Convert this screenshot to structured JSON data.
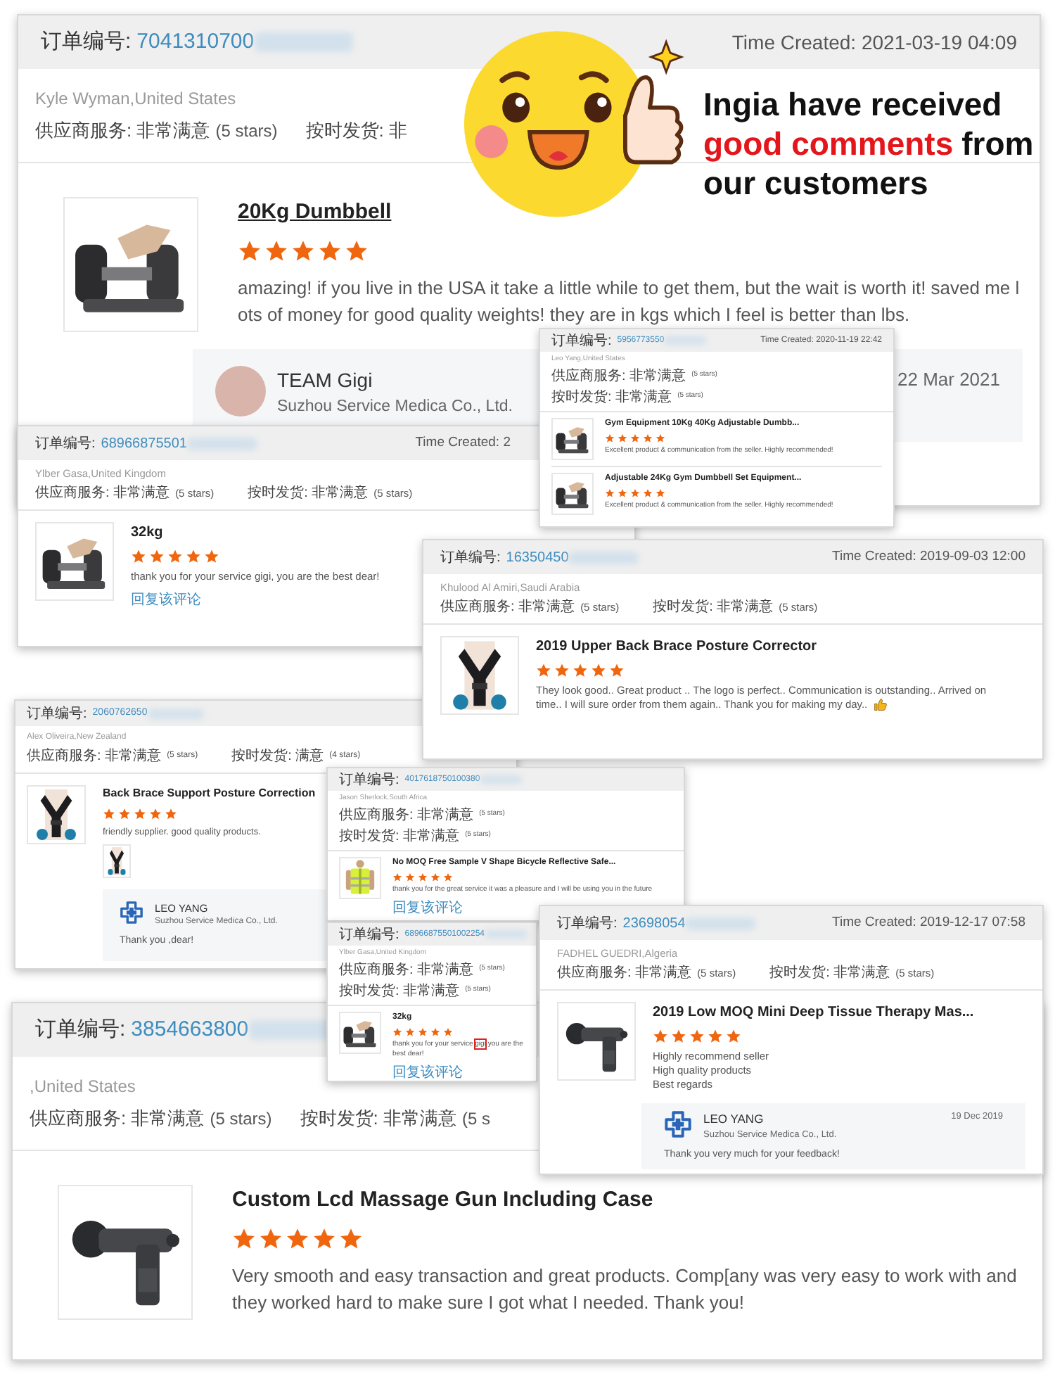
{
  "headline": {
    "lines": [
      [
        {
          "text": "Ingia have received",
          "accent": false
        }
      ],
      [
        {
          "text": "good comments",
          "accent": true
        },
        {
          "text": "from",
          "accent": false
        }
      ],
      [
        {
          "text": "our customers",
          "accent": false
        }
      ]
    ]
  },
  "cards": [
    {
      "order_label": "订单编号:",
      "order_no": "7041310700",
      "time": "Time Created: 2021-03-19 04:09",
      "buyer": "Kyle Wyman,United States",
      "ratings": [
        {
          "label": "供应商服务: 非常满意",
          "stars": "(5 stars)"
        },
        {
          "label": "按时发货: 非"
        }
      ],
      "products": [
        {
          "title": "20Kg Dumbbell",
          "underlined": true,
          "stars": 5,
          "review": [
            "amazing! if you live in the USA it take a little while to get them, but the wait is worth it! saved me l",
            "ots of money for good quality weights! they are in kgs which I feel is better than lbs."
          ]
        }
      ],
      "reply": {
        "kind": "avatar",
        "name": "TEAM Gigi",
        "company": "Suzhou Service Medica Co., Ltd.",
        "date": "22 Mar 2021"
      }
    },
    {
      "order_label": "订单编号:",
      "order_no": "68966875501",
      "time": "Time Created: 2",
      "buyer": "Ylber Gasa,United Kingdom",
      "ratings": [
        {
          "label": "供应商服务: 非常满意",
          "stars": "(5 stars)"
        },
        {
          "label": "按时发货: 非常满意",
          "stars": "(5 stars)"
        }
      ],
      "products": [
        {
          "title": "32kg",
          "underlined": false,
          "stars": 5,
          "review": [
            "thank you for your service gigi, you are the best dear!"
          ],
          "link": "回复该评论"
        }
      ]
    },
    {
      "order_label": "订单编号:",
      "order_no": "5956773550",
      "time": "Time Created: 2020-11-19 22:42",
      "buyer": "Leo Yang,United States",
      "ratings": [
        {
          "label": "供应商服务: 非常满意",
          "stars": "(5 stars)"
        },
        {
          "label": "按时发货: 非常满意",
          "stars": "(5 stars)"
        }
      ],
      "products": [
        {
          "title": "Gym Equipment 10Kg 40Kg Adjustable Dumbb...",
          "underlined": false,
          "stars": 5,
          "review": [
            "Excellent product & communication from the seller. Highly recommended!"
          ]
        },
        {
          "title": "Adjustable 24Kg Gym Dumbbell Set Equipment...",
          "underlined": false,
          "stars": 5,
          "review": [
            "Excellent product & communication from the seller. Highly recommended!"
          ]
        }
      ]
    },
    {
      "order_label": "订单编号:",
      "order_no": "16350450",
      "time": "Time Created: 2019-09-03 12:00",
      "buyer": "Khulood Al Amiri,Saudi Arabia",
      "ratings": [
        {
          "label": "供应商服务: 非常满意",
          "stars": "(5 stars)"
        },
        {
          "label": "按时发货: 非常满意",
          "stars": "(5 stars)"
        }
      ],
      "products": [
        {
          "title": "2019 Upper Back Brace Posture Corrector",
          "underlined": false,
          "stars": 5,
          "review": [
            "They look good.. Great product .. The logo is perfect.. Communication is outstanding.. Arrived on",
            "time.. I will sure order from them again.. Thank you for making my day.."
          ],
          "thumbs_up": true
        }
      ]
    },
    {
      "order_label": "订单编号:",
      "order_no": "2060762650",
      "buyer": "Alex Oliveira,New Zealand",
      "ratings": [
        {
          "label": "供应商服务: 非常满意",
          "stars": "(5 stars)"
        },
        {
          "label": "按时发货: 满意",
          "stars": "(4 stars)"
        }
      ],
      "products": [
        {
          "title": "Back Brace Support Posture Correction",
          "underlined": false,
          "stars": 5,
          "review": [
            "friendly supplier. good quality products."
          ],
          "photos": [
            {
              "kind": "picture"
            }
          ]
        }
      ],
      "reply": {
        "kind": "logo",
        "name": "LEO YANG",
        "company": "Suzhou Service Medica Co., Ltd.",
        "message": "Thank you ,dear!"
      }
    },
    {
      "order_label": "订单编号:",
      "order_no": "4017618750100380",
      "buyer": "Jason Sherlock,South Africa",
      "ratings": [
        {
          "label": "供应商服务: 非常满意",
          "stars": "(5 stars)"
        },
        {
          "label": "按时发货: 非常满意",
          "stars": "(5 stars)"
        }
      ],
      "products": [
        {
          "title": "No MOQ Free Sample V Shape Bicycle Reflective Safe...",
          "underlined": false,
          "stars": 5,
          "review": [
            "thank you for the great service it was a pleasure and I will be using you in the future"
          ],
          "link": "回复该评论"
        }
      ]
    },
    {
      "order_label": "订单编号:",
      "order_no": "68966875501002254",
      "buyer": "Ylber Gasa,United Kingdom",
      "ratings": [
        {
          "label": "供应商服务: 非常满意",
          "stars": "(5 stars)"
        },
        {
          "label": "按时发货: 非常满意",
          "stars": "(5 stars)"
        }
      ],
      "products": [
        {
          "title": "32kg",
          "underlined": false,
          "stars": 5,
          "review": [
            [
              {
                "text": "thank you for your service ",
                "marked": false
              },
              {
                "text": "gigi",
                "marked": true
              },
              {
                "text": " you are the best dear!",
                "marked": false
              }
            ]
          ],
          "link": "回复该评论"
        }
      ]
    },
    {
      "order_label": "订单编号:",
      "order_no": "23698054",
      "time": "Time Created: 2019-12-17 07:58",
      "buyer": "FADHEL GUEDRI,Algeria",
      "ratings": [
        {
          "label": "供应商服务: 非常满意",
          "stars": "(5 stars)"
        },
        {
          "label": "按时发货: 非常满意",
          "stars": "(5 stars)"
        }
      ],
      "products": [
        {
          "title": "2019 Low MOQ Mini Deep Tissue Therapy Mas...",
          "underlined": false,
          "stars": 5,
          "review": [
            "Highly recommend seller",
            "High quality products",
            "Best regards"
          ]
        }
      ],
      "reply": {
        "kind": "logo",
        "name": "LEO YANG",
        "company": "Suzhou Service Medica Co., Ltd.",
        "date": "19 Dec 2019",
        "message": "Thank you very much for your feedback!"
      }
    },
    {
      "order_label": "订单编号:",
      "order_no": "3854663800",
      "buyer": ",United States",
      "ratings": [
        {
          "label": "供应商服务: 非常满意",
          "stars": "(5 stars)"
        },
        {
          "label": "按时发货: 非常满意",
          "stars": "(5 s"
        }
      ],
      "products": [
        {
          "title": "Custom Lcd Massage Gun Including Case",
          "underlined": false,
          "stars": 5,
          "review": [
            "Very smooth and easy transaction and great products. Comp[any was very easy to work with and",
            "they worked hard to make sure I got what I needed. Thank you!"
          ]
        }
      ]
    }
  ]
}
